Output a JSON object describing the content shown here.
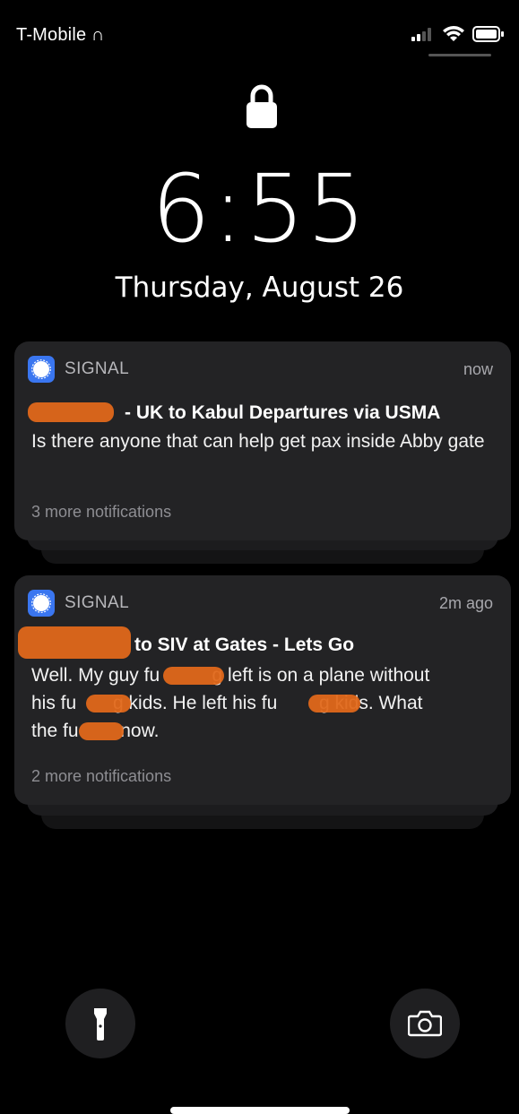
{
  "status_bar": {
    "carrier": "T-Mobile ∩",
    "signal_icon": "cellular-signal-icon",
    "wifi_icon": "wifi-icon",
    "battery_icon": "battery-icon"
  },
  "lock_screen": {
    "lock_icon": "lock-icon",
    "time": "6:55",
    "date": "Thursday, August 26"
  },
  "notifications": [
    {
      "app": "SIGNAL",
      "time": "now",
      "title": "- UK to Kabul Departures via USMA",
      "body": "Is there anyone that can help get pax inside Abby gate",
      "more": "3 more notifications"
    },
    {
      "app": "SIGNAL",
      "time": "2m ago",
      "title": "to SIV at Gates - Lets Go",
      "body_line1": "Well. My guy fu          g left is on a plane without",
      "body_line2": "his fu       g kids. He left his fu        g kids. What",
      "body_line3": "the fu        now.",
      "more": "2 more notifications"
    }
  ],
  "quick_actions": {
    "flashlight": "flashlight-icon",
    "camera": "camera-icon"
  },
  "colors": {
    "background": "#000000",
    "card": "#232325",
    "signal_blue": "#3a76f0",
    "redaction": "#e0681a"
  }
}
